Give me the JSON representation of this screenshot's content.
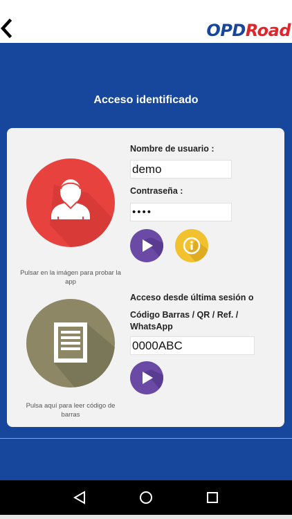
{
  "header": {
    "back_icon": "chevron-left-icon",
    "logo_part1": "OPD",
    "logo_part2": "Road",
    "logo_colors": {
      "opd": "#17479c",
      "road": "#e0262b"
    }
  },
  "main": {
    "title": "Acceso identificado",
    "background": "#17479c"
  },
  "login": {
    "avatar_icon": "user-avatar-icon",
    "avatar_caption": "Pulsar en la imágen para probar la app",
    "username_label": "Nombre de usuario :",
    "username_value": "demo",
    "password_label": "Contraseña :",
    "password_value": "••••",
    "submit_icon": "play-icon",
    "info_icon": "info-icon"
  },
  "code_access": {
    "document_icon": "document-icon",
    "caption": "Pulsa aquí para leer código de barras",
    "last_session_label": "Acceso desde última sesión o",
    "codes_label": "Código Barras / QR / Ref. / WhatsApp",
    "code_value": "0000ABC",
    "submit_icon": "play-icon"
  },
  "system_nav": {
    "back_icon": "triangle-back-icon",
    "home_icon": "circle-home-icon",
    "recent_icon": "square-recent-icon"
  }
}
